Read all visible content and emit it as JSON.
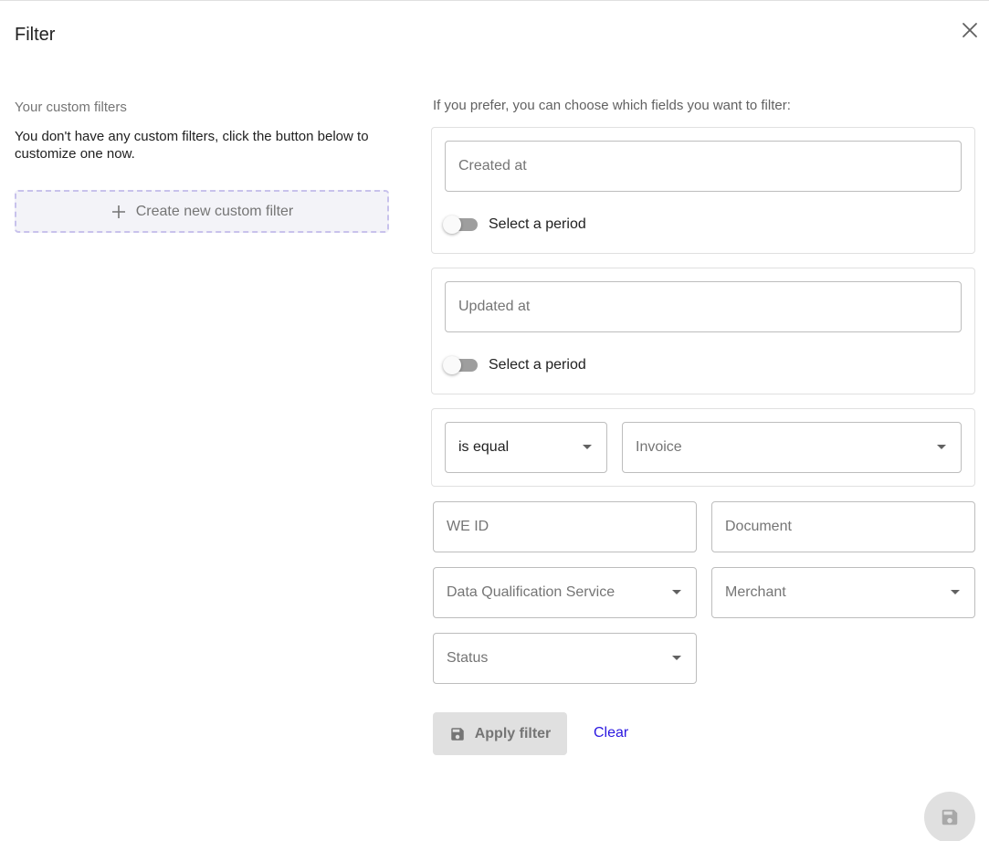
{
  "dialog": {
    "title": "Filter"
  },
  "custom_filters": {
    "heading": "Your custom filters",
    "empty_text": "You don't have any custom filters, click the button below to customize one now.",
    "create_label": "Create new custom filter"
  },
  "fields_section": {
    "heading": "If you prefer, you can choose which fields you want to filter:",
    "created_at": {
      "placeholder": "Created at",
      "toggle_label": "Select a period",
      "toggle_on": false
    },
    "updated_at": {
      "placeholder": "Updated at",
      "toggle_label": "Select a period",
      "toggle_on": false
    },
    "comparison": {
      "operator_value": "is equal",
      "type_placeholder": "Invoice"
    },
    "we_id": {
      "placeholder": "WE ID"
    },
    "document": {
      "placeholder": "Document"
    },
    "data_qualification_service": {
      "placeholder": "Data Qualification Service"
    },
    "merchant": {
      "placeholder": "Merchant"
    },
    "status": {
      "placeholder": "Status"
    }
  },
  "actions": {
    "apply_label": "Apply filter",
    "clear_label": "Clear"
  },
  "colors": {
    "accent_link": "#2a17e0",
    "dashed_border": "#c8c2ec",
    "disabled_bg": "#e0e0e0"
  }
}
